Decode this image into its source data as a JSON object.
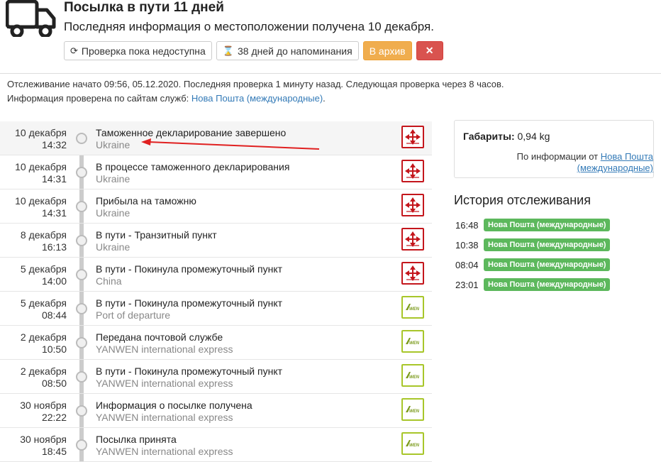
{
  "header": {
    "title": "Посылка в пути 11 дней",
    "subtitle": "Последняя информация о местоположении получена 10 декабря."
  },
  "buttons": {
    "check": "Проверка пока недоступна",
    "reminder": "38 дней до напоминания",
    "archive": "В архив",
    "close": "✕"
  },
  "info": {
    "line1": "Отслеживание начато 09:56, 05.12.2020. Последняя проверка 1 минуту назад. Следующая проверка через 8 часов.",
    "line2_prefix": "Информация проверена по сайтам служб:",
    "line2_link": "Нова Пошта (международные)",
    "line2_suffix": "."
  },
  "events": [
    {
      "date": "10 декабря",
      "time": "14:32",
      "event": "Таможенное декларирование завершено",
      "location": "Ukraine",
      "carrier": "nova"
    },
    {
      "date": "10 декабря",
      "time": "14:31",
      "event": "В процессе таможенного декларирования",
      "location": "Ukraine",
      "carrier": "nova"
    },
    {
      "date": "10 декабря",
      "time": "14:31",
      "event": "Прибыла на таможню",
      "location": "Ukraine",
      "carrier": "nova"
    },
    {
      "date": "8 декабря",
      "time": "16:13",
      "event": "В пути - Транзитный пункт",
      "location": "Ukraine",
      "carrier": "nova"
    },
    {
      "date": "5 декабря",
      "time": "14:00",
      "event": "В пути - Покинула промежуточный пункт",
      "location": "China",
      "carrier": "nova"
    },
    {
      "date": "5 декабря",
      "time": "08:44",
      "event": "В пути - Покинула промежуточный пункт",
      "location": "Port of departure",
      "carrier": "yanwen"
    },
    {
      "date": "2 декабря",
      "time": "10:50",
      "event": "Передана почтовой службе",
      "location": "YANWEN international express",
      "carrier": "yanwen"
    },
    {
      "date": "2 декабря",
      "time": "08:50",
      "event": "В пути - Покинула промежуточный пункт",
      "location": "YANWEN international express",
      "carrier": "yanwen"
    },
    {
      "date": "30 ноября",
      "time": "22:22",
      "event": "Информация о посылке получена",
      "location": "YANWEN international express",
      "carrier": "yanwen"
    },
    {
      "date": "30 ноября",
      "time": "18:45",
      "event": "Посылка принята",
      "location": "YANWEN international express",
      "carrier": "yanwen"
    }
  ],
  "sidebar": {
    "dims_label": "Габариты:",
    "dims_value": "0,94 kg",
    "source_prefix": "По информации от",
    "source_link": "Нова Пошта (международные)",
    "history_title": "История отслеживания",
    "history": [
      {
        "time": "16:48",
        "service": "Нова Пошта (международные)"
      },
      {
        "time": "10:38",
        "service": "Нова Пошта (международные)"
      },
      {
        "time": "08:04",
        "service": "Нова Пошта (международные)"
      },
      {
        "time": "23:01",
        "service": "Нова Пошта (международные)"
      }
    ]
  },
  "colors": {
    "archive": "#f0ad4e",
    "close": "#d9534f",
    "badge": "#5cb85c",
    "link": "#337ab7",
    "nova": "#c4161c",
    "yanwen": "#a8c62a"
  }
}
